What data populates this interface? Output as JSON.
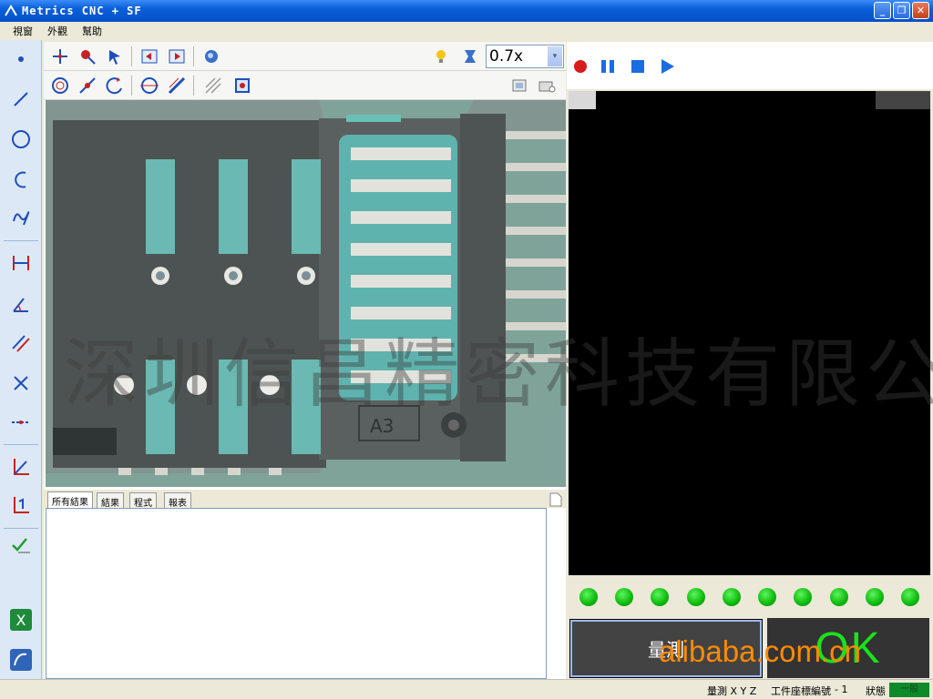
{
  "window": {
    "title": "Metrics  CNC + SF",
    "minimize": "_",
    "restore": "❐",
    "close": "✕"
  },
  "menu": [
    "視窗",
    "外觀",
    "幫助"
  ],
  "toolbar": {
    "zoom_value": "0.7x",
    "zoom_dropdown_glyph": "▾"
  },
  "left_tools": [
    "point-icon",
    "line-icon",
    "circle-icon",
    "arc-icon",
    "curve-icon",
    "distance-icon",
    "angle-icon",
    "parallel-lines-icon",
    "intersection-icon",
    "midpoint-line-icon",
    "coordinate-icon",
    "datum-icon",
    "check-icon",
    "excel-icon",
    "report-icon"
  ],
  "camera": {
    "part_label": "A3"
  },
  "results_tabs": [
    "所有結果",
    "結果",
    "程式",
    "報表"
  ],
  "playback": [
    "record-icon",
    "pause-icon",
    "stop-icon",
    "play-icon"
  ],
  "leds_count": 10,
  "colors": {
    "led_on": "#0bb80b",
    "ok_text": "#1ae21a",
    "state_badge": "#0f8a2b",
    "record": "#d81b1b",
    "playback": "#1a6de0"
  },
  "measure_button": "量測",
  "ok_label": "OK",
  "status": {
    "mode": "量測 X Y Z",
    "coord_label": "工件座標編號",
    "coord_value": "- 1",
    "state_label": "狀態",
    "state_value": "一般"
  },
  "watermark": "深圳信昌精密科技有限公司",
  "site_watermark": "alibaba.com.cn"
}
